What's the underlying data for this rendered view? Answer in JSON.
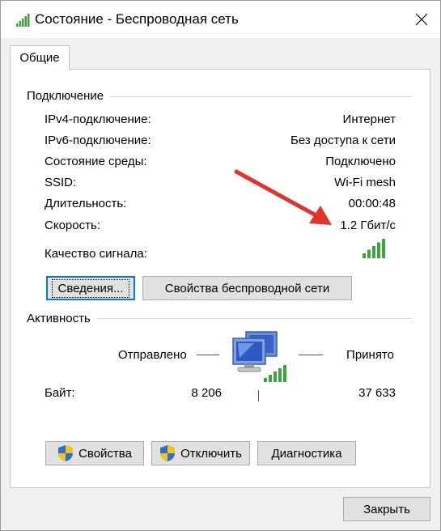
{
  "window": {
    "title": "Состояние - Беспроводная сеть",
    "icon": "wifi-signal-icon",
    "close_icon": "close-icon"
  },
  "tabs": [
    {
      "label": "Общие",
      "active": true
    }
  ],
  "connection": {
    "group_title": "Подключение",
    "rows": [
      {
        "label": "IPv4-подключение:",
        "value": "Интернет"
      },
      {
        "label": "IPv6-подключение:",
        "value": "Без доступа к сети"
      },
      {
        "label": "Состояние среды:",
        "value": "Подключено"
      },
      {
        "label": "SSID:",
        "value": "Wi-Fi mesh"
      },
      {
        "label": "Длительность:",
        "value": "00:00:48"
      },
      {
        "label": "Скорость:",
        "value": "1.2 Гбит/с"
      }
    ],
    "signal_label": "Качество сигнала:",
    "signal_bars": 5,
    "signal_bars_max": 5,
    "details_button": "Сведения...",
    "wireless_props_button": "Свойства беспроводной сети"
  },
  "activity": {
    "group_title": "Активность",
    "sent_label": "Отправлено",
    "received_label": "Принято",
    "bytes_label": "Байт:",
    "bytes_sent": "8 206",
    "bytes_received": "37 633"
  },
  "buttons": {
    "properties": "Свойства",
    "disable": "Отключить",
    "diagnostics": "Диагностика",
    "close": "Закрыть"
  },
  "colors": {
    "signal_green": "#3aa53a",
    "arrow_red": "#e0352b",
    "focus_blue": "#0078d7"
  }
}
